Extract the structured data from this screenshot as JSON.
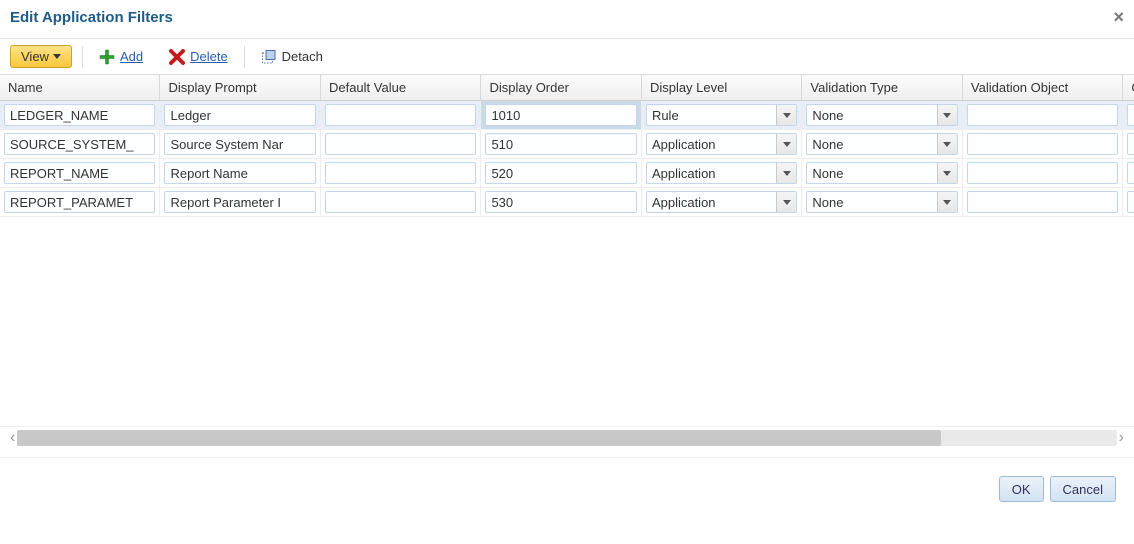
{
  "title": "Edit Application Filters",
  "toolbar": {
    "view_label": "View",
    "add_label": "Add",
    "delete_label": "Delete",
    "detach_label": "Detach"
  },
  "columns": {
    "name": "Name",
    "display_prompt": "Display Prompt",
    "default_value": "Default Value",
    "display_order": "Display Order",
    "display_level": "Display Level",
    "validation_type": "Validation Type",
    "validation_object": "Validation Object",
    "condition": "Co"
  },
  "rows": [
    {
      "selected": true,
      "name": "LEDGER_NAME",
      "display_prompt": "Ledger",
      "default_value": "",
      "display_order": "1010",
      "display_level": "Rule",
      "validation_type": "None",
      "validation_object": ""
    },
    {
      "selected": false,
      "name": "SOURCE_SYSTEM_",
      "display_prompt": "Source System Nar",
      "default_value": "",
      "display_order": "510",
      "display_level": "Application",
      "validation_type": "None",
      "validation_object": ""
    },
    {
      "selected": false,
      "name": "REPORT_NAME",
      "display_prompt": "Report Name",
      "default_value": "",
      "display_order": "520",
      "display_level": "Application",
      "validation_type": "None",
      "validation_object": ""
    },
    {
      "selected": false,
      "name": "REPORT_PARAMET",
      "display_prompt": "Report Parameter I",
      "default_value": "",
      "display_order": "530",
      "display_level": "Application",
      "validation_type": "None",
      "validation_object": ""
    }
  ],
  "buttons": {
    "ok": "OK",
    "cancel": "Cancel"
  }
}
